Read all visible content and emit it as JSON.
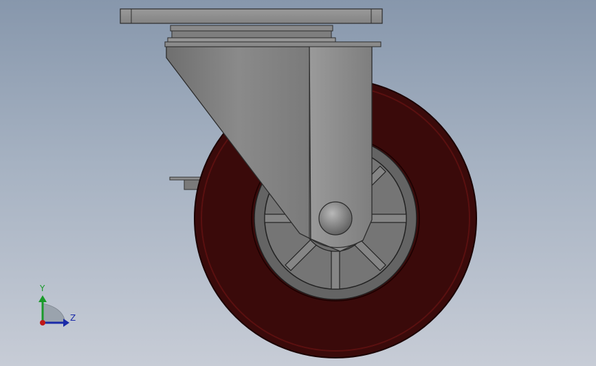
{
  "viewport": {
    "background_top": "#8797ac",
    "background_bottom": "#c7ccd6"
  },
  "model": {
    "name": "swivel-caster-wheel",
    "wheel_tire_color": "#3a0a0a",
    "wheel_rim_color": "#6e1717",
    "hub_color": "#6a6a6a",
    "bracket_color": "#8a8a8a",
    "top_plate_color": "#8c8c8c"
  },
  "triad": {
    "y_label": "Y",
    "z_label": "Z",
    "y_color": "#1a9a2a",
    "z_color": "#1a2aa8",
    "x_color": "#c01818"
  }
}
